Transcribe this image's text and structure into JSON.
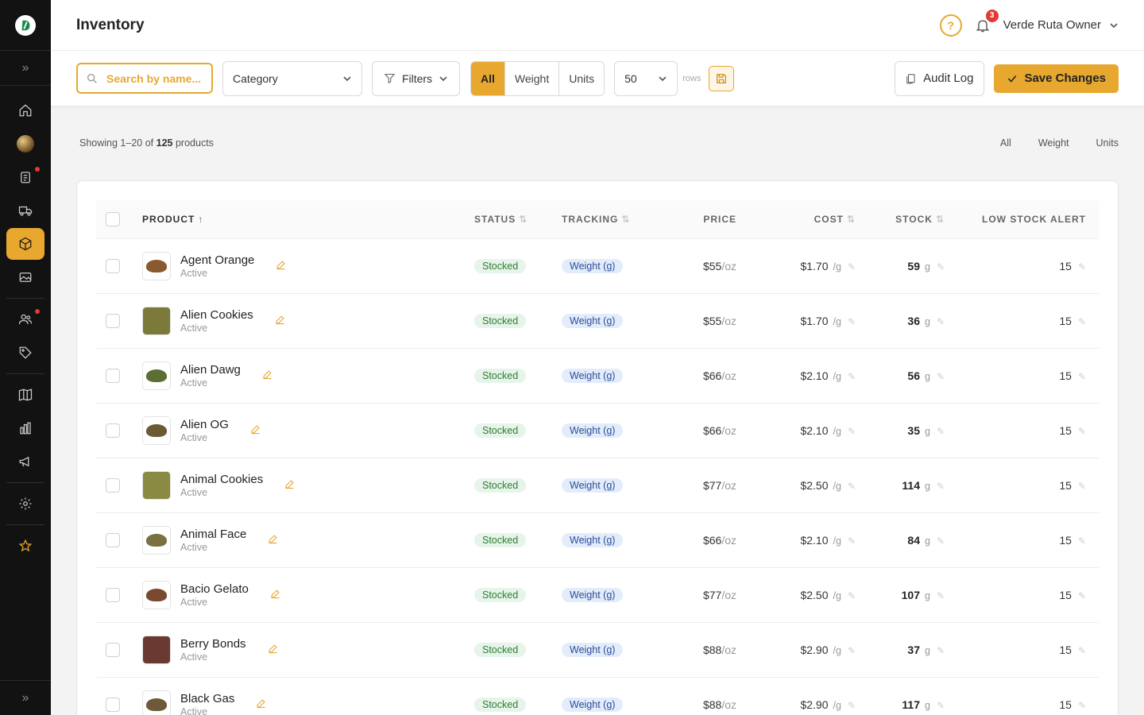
{
  "header": {
    "title": "Inventory",
    "notifications_count": "3",
    "user_name": "Verde Ruta Owner"
  },
  "toolbar": {
    "search_placeholder": "Search by name...",
    "category_label": "Category",
    "filters_label": "Filters",
    "segments": [
      "All",
      "Weight",
      "Units"
    ],
    "active_segment": "All",
    "rows_value": "50",
    "rows_label": "rows",
    "audit_label": "Audit Log",
    "save_label": "Save Changes"
  },
  "summary": {
    "prefix": "Showing 1–20 of",
    "total": "125",
    "suffix": "products",
    "views": [
      "All",
      "Weight",
      "Units"
    ]
  },
  "table": {
    "headers": {
      "product": "PRODUCT",
      "status": "STATUS",
      "tracking": "TRACKING",
      "price": "PRICE",
      "cost": "COST",
      "stock": "STOCK",
      "low": "LOW STOCK ALERT"
    },
    "rows": [
      {
        "name": "Agent Orange",
        "state": "Active",
        "status": "Stocked",
        "tracking": "Weight (g)",
        "price": "$55",
        "price_unit": "/oz",
        "cost": "$1.70",
        "cost_unit": "/g",
        "stock": "59",
        "stock_unit": "g",
        "low": "15",
        "thumb": "#8a5a2e"
      },
      {
        "name": "Alien Cookies",
        "state": "Active",
        "status": "Stocked",
        "tracking": "Weight (g)",
        "price": "$55",
        "price_unit": "/oz",
        "cost": "$1.70",
        "cost_unit": "/g",
        "stock": "36",
        "stock_unit": "g",
        "low": "15",
        "thumb": "#7b7a3a"
      },
      {
        "name": "Alien Dawg",
        "state": "Active",
        "status": "Stocked",
        "tracking": "Weight (g)",
        "price": "$66",
        "price_unit": "/oz",
        "cost": "$2.10",
        "cost_unit": "/g",
        "stock": "56",
        "stock_unit": "g",
        "low": "15",
        "thumb": "#5d6e34"
      },
      {
        "name": "Alien OG",
        "state": "Active",
        "status": "Stocked",
        "tracking": "Weight (g)",
        "price": "$66",
        "price_unit": "/oz",
        "cost": "$2.10",
        "cost_unit": "/g",
        "stock": "35",
        "stock_unit": "g",
        "low": "15",
        "thumb": "#6b5a34"
      },
      {
        "name": "Animal Cookies",
        "state": "Active",
        "status": "Stocked",
        "tracking": "Weight (g)",
        "price": "$77",
        "price_unit": "/oz",
        "cost": "$2.50",
        "cost_unit": "/g",
        "stock": "114",
        "stock_unit": "g",
        "low": "15",
        "thumb": "#8a8a42"
      },
      {
        "name": "Animal Face",
        "state": "Active",
        "status": "Stocked",
        "tracking": "Weight (g)",
        "price": "$66",
        "price_unit": "/oz",
        "cost": "$2.10",
        "cost_unit": "/g",
        "stock": "84",
        "stock_unit": "g",
        "low": "15",
        "thumb": "#7a7040"
      },
      {
        "name": "Bacio Gelato",
        "state": "Active",
        "status": "Stocked",
        "tracking": "Weight (g)",
        "price": "$77",
        "price_unit": "/oz",
        "cost": "$2.50",
        "cost_unit": "/g",
        "stock": "107",
        "stock_unit": "g",
        "low": "15",
        "thumb": "#7a4a30"
      },
      {
        "name": "Berry Bonds",
        "state": "Active",
        "status": "Stocked",
        "tracking": "Weight (g)",
        "price": "$88",
        "price_unit": "/oz",
        "cost": "$2.90",
        "cost_unit": "/g",
        "stock": "37",
        "stock_unit": "g",
        "low": "15",
        "thumb": "#6a3a32"
      },
      {
        "name": "Black Gas",
        "state": "Active",
        "status": "Stocked",
        "tracking": "Weight (g)",
        "price": "$88",
        "price_unit": "/oz",
        "cost": "$2.90",
        "cost_unit": "/g",
        "stock": "117",
        "stock_unit": "g",
        "low": "15",
        "thumb": "#6d5a3a"
      }
    ]
  },
  "colors": {
    "accent": "#e8a830",
    "sidebar": "#121212",
    "stocked_bg": "#e6f4ea",
    "tracking_bg": "#e3ecfb"
  }
}
